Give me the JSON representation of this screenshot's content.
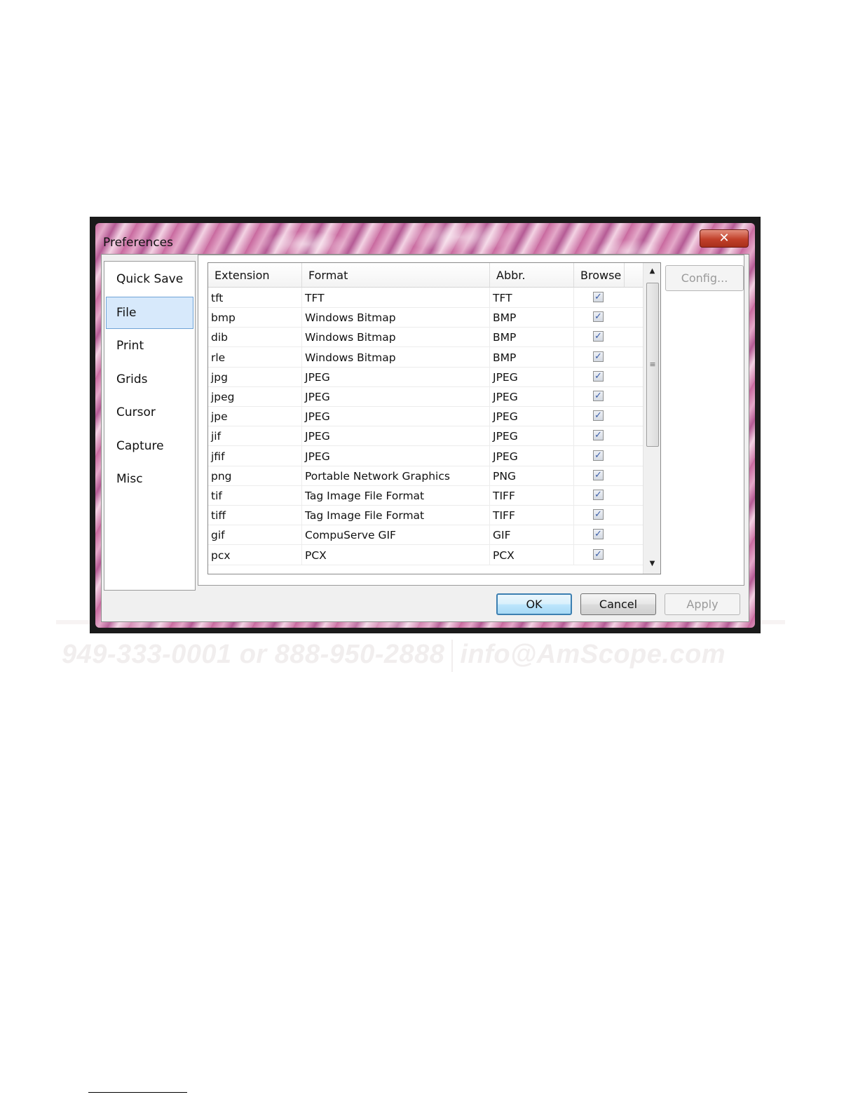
{
  "watermark": {
    "contact": "949-333-0001 or 888-950-2888",
    "email": "info@AmScope.com"
  },
  "dialog": {
    "title": "Preferences",
    "close_label": "✕",
    "nav_items": [
      {
        "label": "Quick Save",
        "selected": false
      },
      {
        "label": "File",
        "selected": true
      },
      {
        "label": "Print",
        "selected": false
      },
      {
        "label": "Grids",
        "selected": false
      },
      {
        "label": "Cursor",
        "selected": false
      },
      {
        "label": "Capture",
        "selected": false
      },
      {
        "label": "Misc",
        "selected": false
      }
    ],
    "table": {
      "columns": [
        "Extension",
        "Format",
        "Abbr.",
        "Browse"
      ],
      "rows": [
        {
          "extension": "tft",
          "format": "TFT",
          "abbr": "TFT",
          "browse": true
        },
        {
          "extension": "bmp",
          "format": "Windows Bitmap",
          "abbr": "BMP",
          "browse": true
        },
        {
          "extension": "dib",
          "format": "Windows Bitmap",
          "abbr": "BMP",
          "browse": true
        },
        {
          "extension": "rle",
          "format": "Windows Bitmap",
          "abbr": "BMP",
          "browse": true
        },
        {
          "extension": "jpg",
          "format": "JPEG",
          "abbr": "JPEG",
          "browse": true
        },
        {
          "extension": "jpeg",
          "format": "JPEG",
          "abbr": "JPEG",
          "browse": true
        },
        {
          "extension": "jpe",
          "format": "JPEG",
          "abbr": "JPEG",
          "browse": true
        },
        {
          "extension": "jif",
          "format": "JPEG",
          "abbr": "JPEG",
          "browse": true
        },
        {
          "extension": "jfif",
          "format": "JPEG",
          "abbr": "JPEG",
          "browse": true
        },
        {
          "extension": "png",
          "format": "Portable Network Graphics",
          "abbr": "PNG",
          "browse": true
        },
        {
          "extension": "tif",
          "format": "Tag Image File Format",
          "abbr": "TIFF",
          "browse": true
        },
        {
          "extension": "tiff",
          "format": "Tag Image File Format",
          "abbr": "TIFF",
          "browse": true
        },
        {
          "extension": "gif",
          "format": "CompuServe GIF",
          "abbr": "GIF",
          "browse": true
        },
        {
          "extension": "pcx",
          "format": "PCX",
          "abbr": "PCX",
          "browse": true
        }
      ]
    },
    "buttons": {
      "config": "Config...",
      "ok": "OK",
      "cancel": "Cancel",
      "apply": "Apply"
    },
    "icons": {
      "scroll_up": "▲",
      "scroll_down": "▼",
      "grip": "≡",
      "check": "✓"
    }
  }
}
